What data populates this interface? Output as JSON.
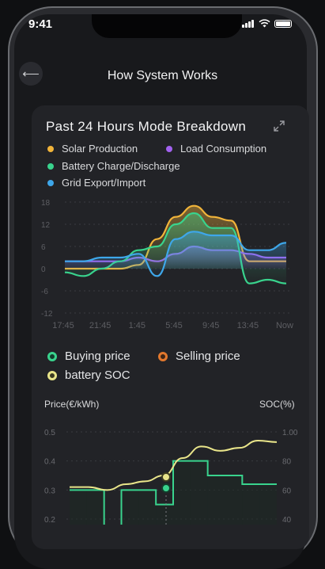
{
  "status_bar": {
    "time": "9:41"
  },
  "header": {
    "title": "How System Works",
    "back_icon": "arrow-left-icon"
  },
  "card": {
    "title": "Past 24 Hours Mode Breakdown",
    "expand_icon": "expand-icon",
    "legend": [
      {
        "label": "Solar Production",
        "color": "#f1b43a"
      },
      {
        "label": "Load Consumption",
        "color": "#a262f0"
      },
      {
        "label": "Battery Charge/Discharge",
        "color": "#39d38d"
      },
      {
        "label": "Grid Export/Import",
        "color": "#3ea7ea"
      }
    ],
    "price_legend": [
      {
        "label": "Buying price",
        "color": "#39d38d"
      },
      {
        "label": "Selling price",
        "color": "#e2782d"
      },
      {
        "label": "battery SOC",
        "color": "#e9e58a"
      }
    ],
    "price_axis_left": "Price(€/kWh)",
    "price_axis_right": "SOC(%)"
  },
  "chart_data": [
    {
      "type": "line",
      "title": "Past 24 Hours Mode Breakdown",
      "x": [
        "17:45",
        "19:45",
        "21:45",
        "23:45",
        "1:45",
        "3:45",
        "5:45",
        "7:45",
        "9:45",
        "11:45",
        "13:45",
        "15:45",
        "Now"
      ],
      "x_tick_labels": [
        "17:45",
        "21:45",
        "1:45",
        "5:45",
        "9:45",
        "13:45",
        "Now"
      ],
      "y_tick_labels": [
        "18",
        "12",
        "6",
        "0",
        "-6",
        "-12"
      ],
      "ylim": [
        -12,
        18
      ],
      "series": [
        {
          "name": "Solar Production",
          "color": "#f1b43a",
          "values": [
            0,
            0,
            0,
            0,
            1,
            8,
            14,
            17,
            14,
            13,
            2,
            2,
            2
          ]
        },
        {
          "name": "Load Consumption",
          "color": "#a262f0",
          "values": [
            2,
            2,
            2,
            2,
            3,
            2,
            4,
            6,
            5,
            5,
            4,
            3,
            3
          ]
        },
        {
          "name": "Battery Charge/Discharge",
          "color": "#39d38d",
          "values": [
            -1,
            -2,
            0,
            2,
            5,
            6,
            12,
            15,
            11,
            11,
            -4,
            -3,
            -4
          ]
        },
        {
          "name": "Grid Export/Import",
          "color": "#3ea7ea",
          "values": [
            2,
            2,
            3,
            3,
            4,
            -2,
            8,
            10,
            9,
            9,
            5,
            5,
            7
          ]
        }
      ]
    },
    {
      "type": "line",
      "x_tick_labels": [],
      "y_left_tick_labels": [
        "0.5",
        "0.4",
        "0.3",
        "0.2"
      ],
      "y_right_tick_labels": [
        "1.00",
        "80",
        "60",
        "40"
      ],
      "ylim_left": [
        0.2,
        0.5
      ],
      "ylim_right": [
        40,
        100
      ],
      "series": [
        {
          "name": "Buying price",
          "color": "#39d38d",
          "step": true,
          "values": [
            0.3,
            0.3,
            0.15,
            0.3,
            0.3,
            0.25,
            0.4,
            0.4,
            0.35,
            0.35,
            0.32,
            0.32
          ]
        },
        {
          "name": "battery SOC",
          "color": "#e9e58a",
          "values": [
            62,
            62,
            60,
            64,
            66,
            70,
            82,
            90,
            87,
            89,
            94,
            93
          ]
        }
      ]
    }
  ]
}
